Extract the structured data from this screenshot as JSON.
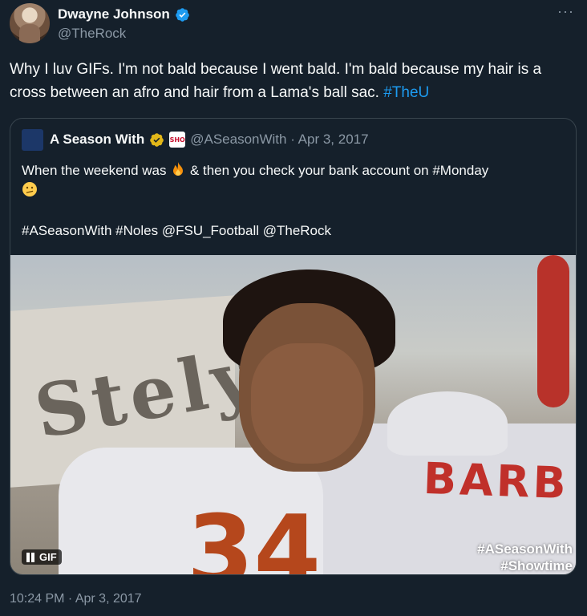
{
  "author": {
    "display_name": "Dwayne Johnson",
    "handle": "@TheRock",
    "more_label": "···"
  },
  "tweet": {
    "text": "Why I luv GIFs. I'm not bald because I went bald. I'm bald because my hair is a cross between an afro and hair from a Lama's ball sac. ",
    "hashtag": "#TheU",
    "timestamp": "10:24 PM · Apr 3, 2017"
  },
  "quote": {
    "display_name": "A Season With",
    "badge_label": "SHO",
    "handle_date": "@ASeasonWith · Apr 3, 2017",
    "line1_a": "When the weekend was ",
    "line1_b": " & then you check your bank account on #Monday",
    "line3": "#ASeasonWith #Noles @FSU_Football @TheRock"
  },
  "media": {
    "type_label": "GIF",
    "banner_text": "Stely",
    "jersey_name": "BARB",
    "jersey_number": "34",
    "watermark_line1": "#ASeasonWith",
    "watermark_line2": "#Showtime"
  },
  "colors": {
    "background": "#15202b",
    "link": "#1d9bf0",
    "verified_blue": "#1d9bf0",
    "verified_gold": "#e2b719",
    "secondary_text": "#8b98a5"
  }
}
